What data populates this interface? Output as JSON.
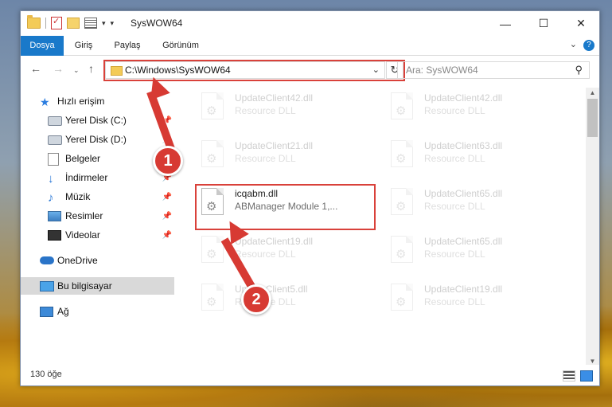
{
  "window": {
    "title": "SysWOW64",
    "controls": {
      "minimize": "—",
      "maximize": "☐",
      "close": "✕"
    }
  },
  "ribbon": {
    "tabs": [
      "Dosya",
      "Giriş",
      "Paylaş",
      "Görünüm"
    ],
    "help_label": "?"
  },
  "navigation": {
    "address": "C:\\Windows\\SysWOW64",
    "search_placeholder": "Ara: SysWOW64"
  },
  "sidebar": {
    "items": [
      {
        "label": "Hızlı erişim",
        "icon": "star-icon",
        "pinned": false
      },
      {
        "label": "Yerel Disk (C:)",
        "icon": "drive-icon",
        "pinned": true
      },
      {
        "label": "Yerel Disk (D:)",
        "icon": "drive-icon",
        "pinned": true
      },
      {
        "label": "Belgeler",
        "icon": "documents-icon",
        "pinned": true
      },
      {
        "label": "İndirmeler",
        "icon": "download-icon",
        "pinned": true
      },
      {
        "label": "Müzik",
        "icon": "music-icon",
        "pinned": true
      },
      {
        "label": "Resimler",
        "icon": "pictures-icon",
        "pinned": true
      },
      {
        "label": "Videolar",
        "icon": "videos-icon",
        "pinned": true
      },
      {
        "label": "OneDrive",
        "icon": "cloud-icon",
        "pinned": false
      },
      {
        "label": "Bu bilgisayar",
        "icon": "computer-icon",
        "pinned": false,
        "selected": true
      },
      {
        "label": "Ağ",
        "icon": "network-icon",
        "pinned": false
      }
    ]
  },
  "files": [
    {
      "name": "UpdateClient42.dll",
      "desc": "Resource DLL",
      "faded": true
    },
    {
      "name": "UpdateClient42.dll",
      "desc": "Resource DLL",
      "faded": true
    },
    {
      "name": "UpdateClient21.dll",
      "desc": "Resource DLL",
      "faded": true
    },
    {
      "name": "UpdateClient63.dll",
      "desc": "Resource DLL",
      "faded": true
    },
    {
      "name": "icqabm.dll",
      "desc": "ABManager Module 1,...",
      "faded": false
    },
    {
      "name": "UpdateClient65.dll",
      "desc": "Resource DLL",
      "faded": true
    },
    {
      "name": "UpdateClient19.dll",
      "desc": "Resource DLL",
      "faded": true
    },
    {
      "name": "UpdateClient65.dll",
      "desc": "Resource DLL",
      "faded": true
    },
    {
      "name": "UpdateClient5.dll",
      "desc": "Resource DLL",
      "faded": true
    },
    {
      "name": "UpdateClient19.dll",
      "desc": "Resource DLL",
      "faded": true
    }
  ],
  "status": {
    "item_count": "130 öğe"
  },
  "annotations": {
    "step1": "1",
    "step2": "2"
  },
  "colors": {
    "accent": "#1979ca",
    "highlight": "#d9413a"
  }
}
